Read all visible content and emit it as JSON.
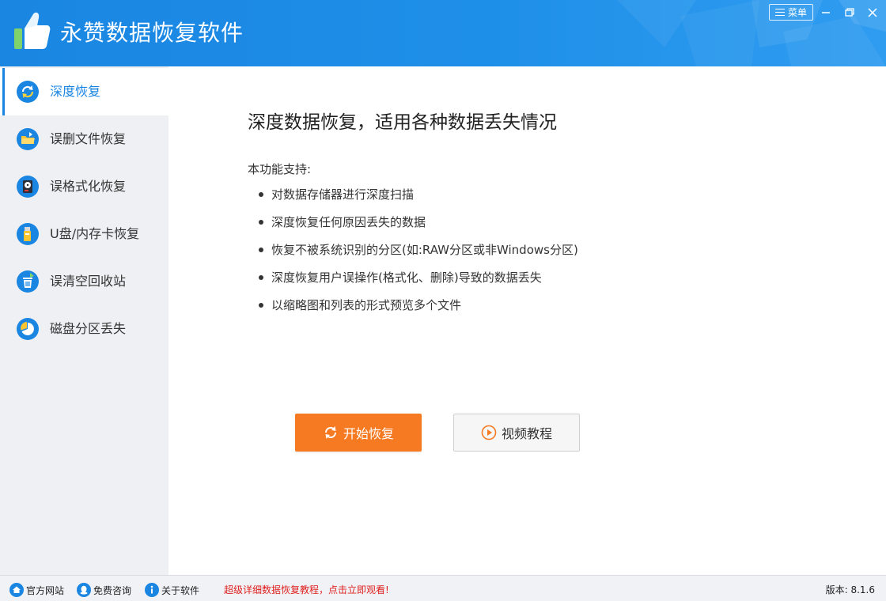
{
  "app": {
    "title": "永赞数据恢复软件",
    "menu_label": "菜单",
    "brand_color": "#1a86e2",
    "accent_color": "#f57a22"
  },
  "sidebar": {
    "items": [
      {
        "label": "深度恢复",
        "icon": "refresh-circle-icon",
        "active": true
      },
      {
        "label": "误删文件恢复",
        "icon": "folder-icon",
        "active": false
      },
      {
        "label": "误格式化恢复",
        "icon": "hard-disk-icon",
        "active": false
      },
      {
        "label": "U盘/内存卡恢复",
        "icon": "usb-drive-icon",
        "active": false
      },
      {
        "label": "误清空回收站",
        "icon": "recycle-bin-icon",
        "active": false
      },
      {
        "label": "磁盘分区丢失",
        "icon": "pie-partition-icon",
        "active": false
      }
    ]
  },
  "main": {
    "heading": "深度数据恢复，适用各种数据丢失情况",
    "support_label": "本功能支持:",
    "features": [
      "对数据存储器进行深度扫描",
      "深度恢复任何原因丢失的数据",
      "恢复不被系统识别的分区(如:RAW分区或非Windows分区)",
      "深度恢复用户误操作(格式化、删除)导致的数据丢失",
      "以缩略图和列表的形式预览多个文件"
    ],
    "start_button": "开始恢复",
    "video_button": "视频教程"
  },
  "statusbar": {
    "links": [
      {
        "label": "官方网站",
        "icon": "home-icon"
      },
      {
        "label": "免费咨询",
        "icon": "qq-icon"
      },
      {
        "label": "关于软件",
        "icon": "info-icon"
      }
    ],
    "promo": "超级详细数据恢复教程，点击立即观看!",
    "version": "版本: 8.1.6"
  }
}
